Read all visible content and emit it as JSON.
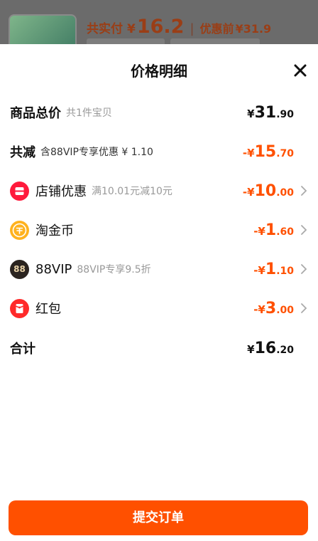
{
  "background": {
    "total_label": "共实付",
    "currency": "¥",
    "total_price": "16.2",
    "before_label": "优惠前",
    "before_price": "¥31.9"
  },
  "sheet": {
    "title": "价格明细",
    "close_icon": "close-icon"
  },
  "rows": {
    "goods_total": {
      "label": "商品总价",
      "sub": "共1件宝贝",
      "sym": "¥",
      "int": "31",
      "dec": ".90"
    },
    "total_discount": {
      "label": "共减",
      "sub": "含88VIP专享优惠 ¥ 1.10",
      "sym": "-¥",
      "int": "15",
      "dec": ".70"
    },
    "shop_coupon": {
      "label": "店铺优惠",
      "sub": "满10.01元减10元",
      "sym": "-¥",
      "int": "10",
      "dec": ".00",
      "icon": "shop-icon"
    },
    "taojinbi": {
      "label": "淘金币",
      "sub": "",
      "sym": "-¥",
      "int": "1",
      "dec": ".60",
      "icon": "gold-coin-icon"
    },
    "vip88": {
      "label": "88VIP",
      "sub": "88VIP专享9.5折",
      "sym": "-¥",
      "int": "1",
      "dec": ".10",
      "icon": "vip88-icon",
      "badge_text": "88"
    },
    "red_packet": {
      "label": "红包",
      "sub": "",
      "sym": "-¥",
      "int": "3",
      "dec": ".00",
      "icon": "red-packet-icon"
    },
    "subtotal": {
      "label": "合计",
      "sym": "¥",
      "int": "16",
      "dec": ".20"
    }
  },
  "footer": {
    "submit_label": "提交订单"
  },
  "colors": {
    "accent": "#ff5000",
    "text": "#111111",
    "muted": "#999999"
  }
}
